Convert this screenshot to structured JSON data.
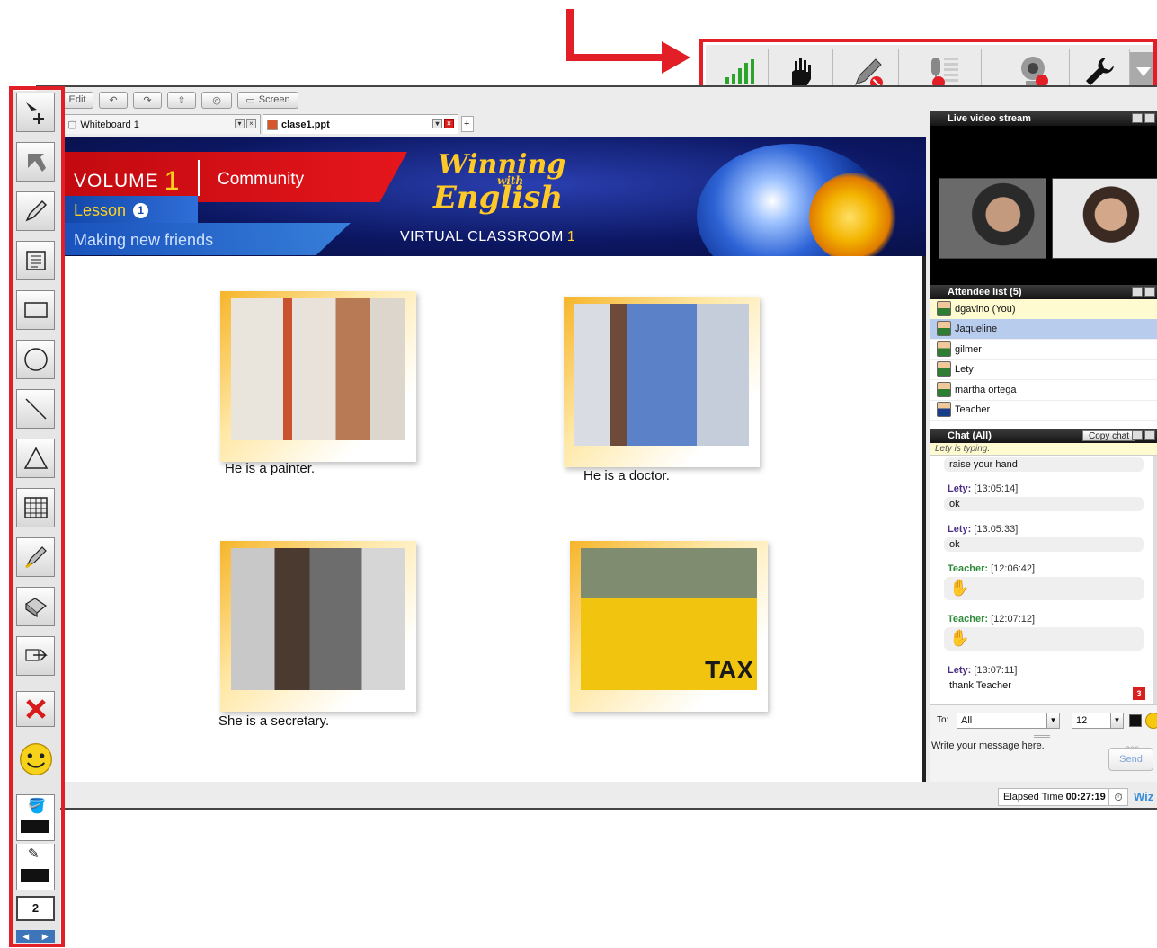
{
  "colors": {
    "accent": "#e21f26",
    "chat_teacher": "#2e8b3a",
    "chat_student": "#4b2e83",
    "brand": "#3a8fd8"
  },
  "menubar": {
    "edit": "Edit",
    "screen": "Screen",
    "icons": [
      "undo-icon",
      "redo-icon",
      "upload-icon",
      "camera-icon",
      "screen-icon"
    ]
  },
  "tabs": [
    {
      "label": "Whiteboard 1"
    },
    {
      "label": "clase1.ppt"
    }
  ],
  "slide": {
    "volume_label": "VOLUME",
    "volume_number": "1",
    "community": "Community",
    "lesson_label": "Lesson",
    "lesson_number": "1",
    "making": "Making new friends",
    "logo_line1": "Winning",
    "logo_line2": "with",
    "logo_line3": "English",
    "virtual_classroom": "VIRTUAL CLASSROOM",
    "virtual_classroom_number": "1",
    "captions": [
      "He is a painter.",
      "He is a doctor.",
      "She is a secretary."
    ],
    "taxi_text": "TAX"
  },
  "video": {
    "title": "Live video stream"
  },
  "attendees": {
    "title": "Attendee list (5)",
    "list": [
      {
        "name": "dgavino (You)",
        "state": "self"
      },
      {
        "name": "Jaqueline",
        "state": "selected"
      },
      {
        "name": "gilmer",
        "state": "normal"
      },
      {
        "name": "Lety",
        "state": "normal"
      },
      {
        "name": "martha ortega",
        "state": "normal"
      },
      {
        "name": "Teacher",
        "state": "teacher"
      }
    ]
  },
  "chat": {
    "title": "Chat (All)",
    "copy_label": "Copy chat",
    "typing": "Lety is typing.",
    "first_line": "raise your hand",
    "messages": [
      {
        "who": "Lety:",
        "time": "[13:05:14]",
        "text": "ok",
        "role": "student"
      },
      {
        "who": "Lety:",
        "time": "[13:05:33]",
        "text": "ok",
        "role": "student"
      },
      {
        "who": "Teacher:",
        "time": "[12:06:42]",
        "text": "",
        "role": "teacher"
      },
      {
        "who": "Teacher:",
        "time": "[12:07:12]",
        "text": "",
        "role": "teacher"
      },
      {
        "who": "Lety:",
        "time": "[13:07:11]",
        "text": "thank  Teacher",
        "role": "student"
      }
    ],
    "unread_count": "3",
    "to_label": "To:",
    "to_value": "All",
    "font_size": "12",
    "placeholder": "Write your message here.",
    "char_limit": "300",
    "send_label": "Send"
  },
  "status": {
    "elapsed_label": "Elapsed Time",
    "elapsed_value": "00:27:19",
    "brand": "Wiz"
  },
  "left_toolbar": {
    "tools": [
      "move-tool-icon",
      "pointer-tool-icon",
      "pencil-tool-icon",
      "text-tool-icon",
      "rectangle-tool-icon",
      "ellipse-tool-icon",
      "line-tool-icon",
      "triangle-tool-icon",
      "table-tool-icon",
      "highlighter-tool-icon",
      "eraser-tool-icon",
      "stamp-tool-icon",
      "delete-icon",
      "smiley-icon"
    ],
    "page_number": "2"
  },
  "top_toolbar": {
    "items": [
      "signal-strength-icon",
      "raise-hand-icon",
      "pen-disabled-icon",
      "mic-disabled-icon",
      "webcam-disabled-icon",
      "settings-wrench-icon"
    ]
  }
}
